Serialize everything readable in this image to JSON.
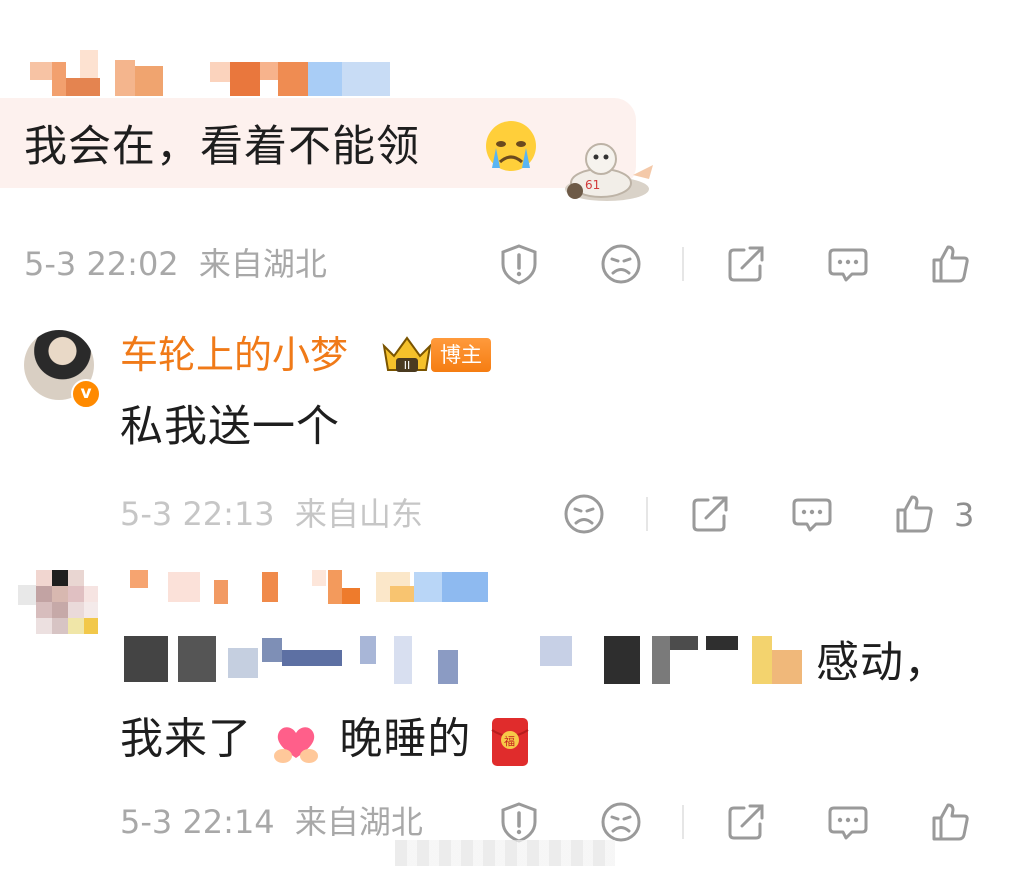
{
  "comments": [
    {
      "username": "",
      "text": "我会在，看着不能领",
      "time": "5-3 22:02",
      "location": "来自湖北"
    },
    {
      "username": "车轮上的小梦",
      "role_badge": "博主",
      "level_badge": "II",
      "text": "私我送一个",
      "time": "5-3 22:13",
      "location": "来自山东",
      "like_count": "3"
    },
    {
      "username": "",
      "text_line1": "感动，",
      "text_line2_a": "我来了",
      "text_line2_b": "晚睡的",
      "time": "5-3 22:14",
      "location": "来自湖北"
    }
  ],
  "icons": {
    "report": "warning-shield-icon",
    "dislike": "sad-face-icon",
    "share": "share-icon",
    "reply": "comment-icon",
    "like": "thumbs-up-icon",
    "emoji_cry": "crying-face-emoji",
    "emoji_heart": "heart-hands-emoji",
    "emoji_redpacket": "red-envelope-emoji",
    "sticker": "toy-plane-sticker"
  },
  "colors": {
    "accent": "#f07a18",
    "meta": "#a8a8a8",
    "bubble": "#fdf1ee"
  }
}
